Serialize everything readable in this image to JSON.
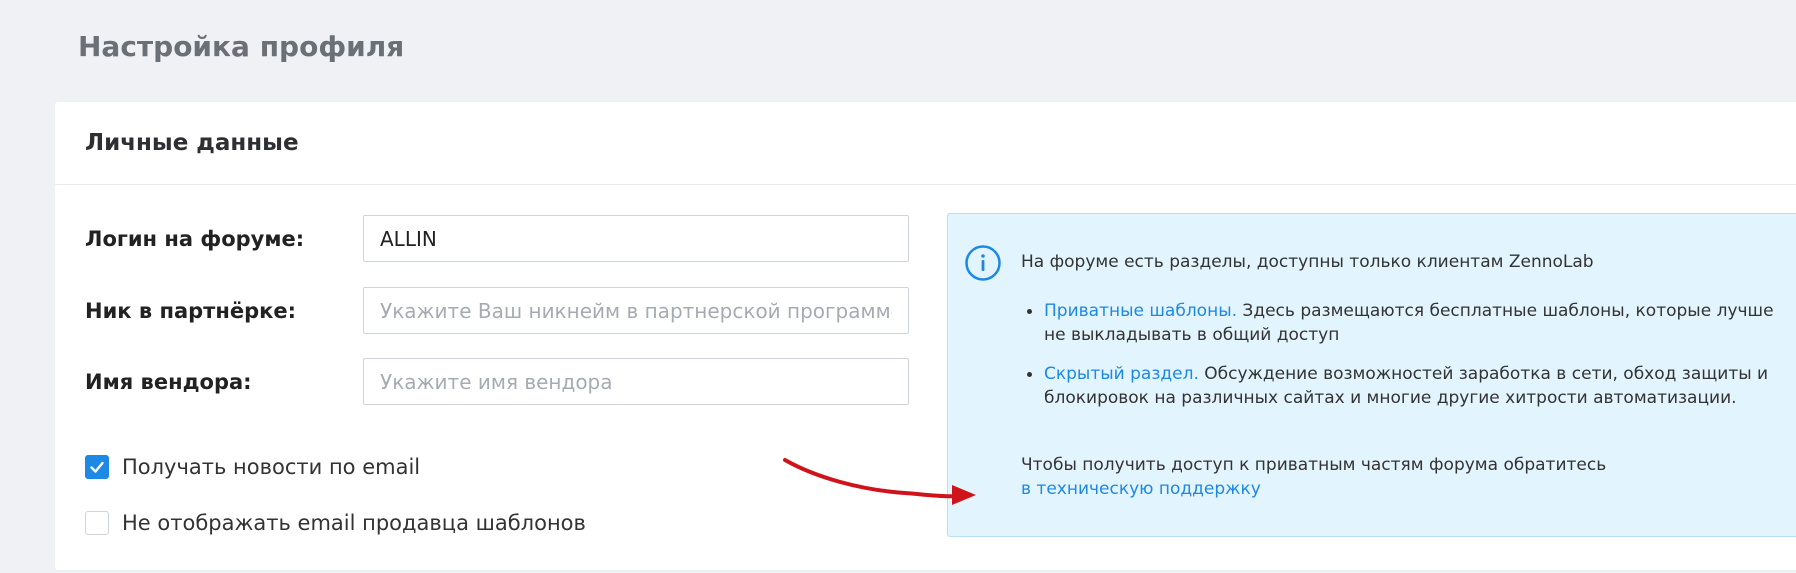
{
  "page": {
    "title": "Настройка профиля"
  },
  "card": {
    "title": "Личные данные"
  },
  "form": {
    "login": {
      "label": "Логин на форуме:",
      "value": "ALLIN",
      "placeholder": ""
    },
    "nick": {
      "label": "Ник в партнёрке:",
      "value": "",
      "placeholder": "Укажите Ваш никнейм в партнерской программе"
    },
    "vendor": {
      "label": "Имя вендора:",
      "value": "",
      "placeholder": "Укажите имя вендора"
    }
  },
  "checkboxes": [
    {
      "label": "Получать новости по email",
      "checked": true
    },
    {
      "label": "Не отображать email продавца шаблонов",
      "checked": false
    }
  ],
  "info": {
    "icon": "info-icon",
    "intro": "На форуме есть разделы, доступны только клиентам ZennoLab",
    "items": [
      {
        "link": "Приватные шаблоны.",
        "text": " Здесь размещаются бесплатные шаблоны, которые лучше не выкладывать в общий доступ"
      },
      {
        "link": "Скрытый раздел.",
        "text": " Обсуждение возможностей заработка в сети, обход защиты и блокировок на различных сайтах и многие другие хитрости автоматизации."
      }
    ],
    "footer_text": "Чтобы получить доступ к приватным частям форума обратитесь",
    "footer_link": "в техническую поддержку"
  },
  "colors": {
    "accent": "#1e88e5",
    "arrow": "#d0131b",
    "info_bg": "#e2f4fd"
  }
}
